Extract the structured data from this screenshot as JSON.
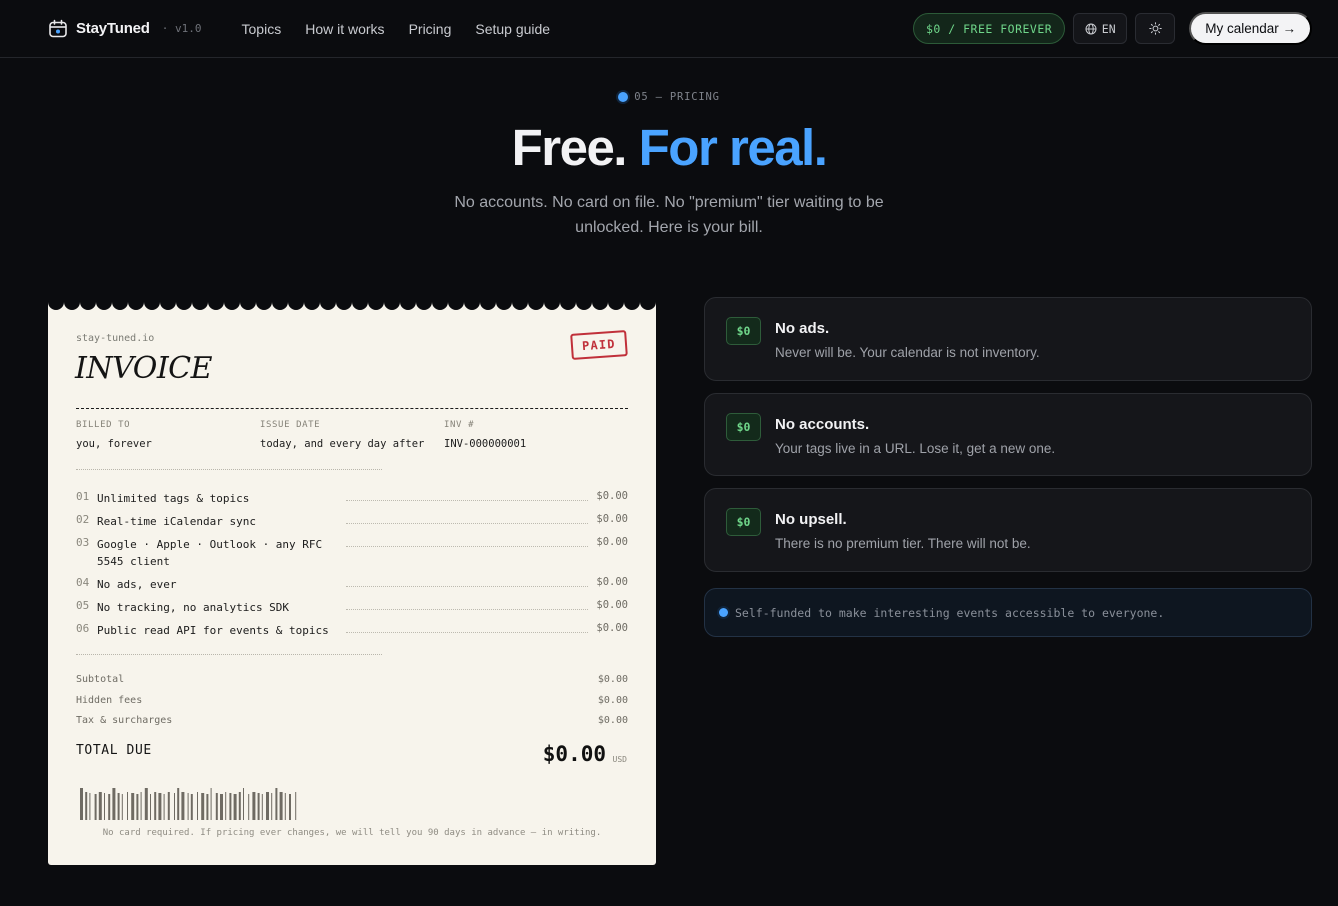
{
  "nav": {
    "brand": "StayTuned",
    "version": "· v1.0",
    "links": [
      "Topics",
      "How it works",
      "Pricing",
      "Setup guide"
    ],
    "free_pill": "$0 / FREE FOREVER",
    "lang": "EN",
    "cta": "My calendar →"
  },
  "hero": {
    "eyebrow": "05 — PRICING",
    "title_a": "Free.",
    "title_b": "For real.",
    "subtitle": "No accounts. No card on file. No \"premium\" tier waiting to be unlocked. Here is your bill."
  },
  "receipt": {
    "domain": "stay-tuned.io",
    "title": "INVOICE",
    "stamp": "PAID",
    "meta": [
      {
        "label": "BILLED TO",
        "value": "you, forever"
      },
      {
        "label": "ISSUE DATE",
        "value": "today, and every day after"
      },
      {
        "label": "INV #",
        "value": "INV-000000001"
      }
    ],
    "items": [
      {
        "num": "01",
        "name": "Unlimited tags & topics",
        "amount": "$0.00"
      },
      {
        "num": "02",
        "name": "Real-time iCalendar sync",
        "amount": "$0.00"
      },
      {
        "num": "03",
        "name": "Google · Apple · Outlook · any RFC 5545 client",
        "amount": "$0.00"
      },
      {
        "num": "04",
        "name": "No ads, ever",
        "amount": "$0.00"
      },
      {
        "num": "05",
        "name": "No tracking, no analytics SDK",
        "amount": "$0.00"
      },
      {
        "num": "06",
        "name": "Public read API for events & topics",
        "amount": "$0.00"
      }
    ],
    "summary": [
      {
        "label": "Subtotal",
        "amount": "$0.00"
      },
      {
        "label": "Hidden fees",
        "amount": "$0.00"
      },
      {
        "label": "Tax & surcharges",
        "amount": "$0.00"
      }
    ],
    "total_label": "TOTAL DUE",
    "total_value": "$0.00",
    "total_currency": "USD",
    "footer": "No card required. If pricing ever changes, we will tell you 90 days in advance — in writing."
  },
  "cards": [
    {
      "badge": "$0",
      "title": "No ads.",
      "desc": "Never will be. Your calendar is not inventory."
    },
    {
      "badge": "$0",
      "title": "No accounts.",
      "desc": "Your tags live in a URL. Lose it, get a new one."
    },
    {
      "badge": "$0",
      "title": "No upsell.",
      "desc": "There is no premium tier. There will not be."
    }
  ],
  "note": "Self-funded to make interesting events accessible to everyone.",
  "colors": {
    "background": "#0b0c0f",
    "accent": "#4aa3ff",
    "free_green": "#6fd68a",
    "paper": "#f7f4ec",
    "stamp_red": "#c0303a"
  }
}
